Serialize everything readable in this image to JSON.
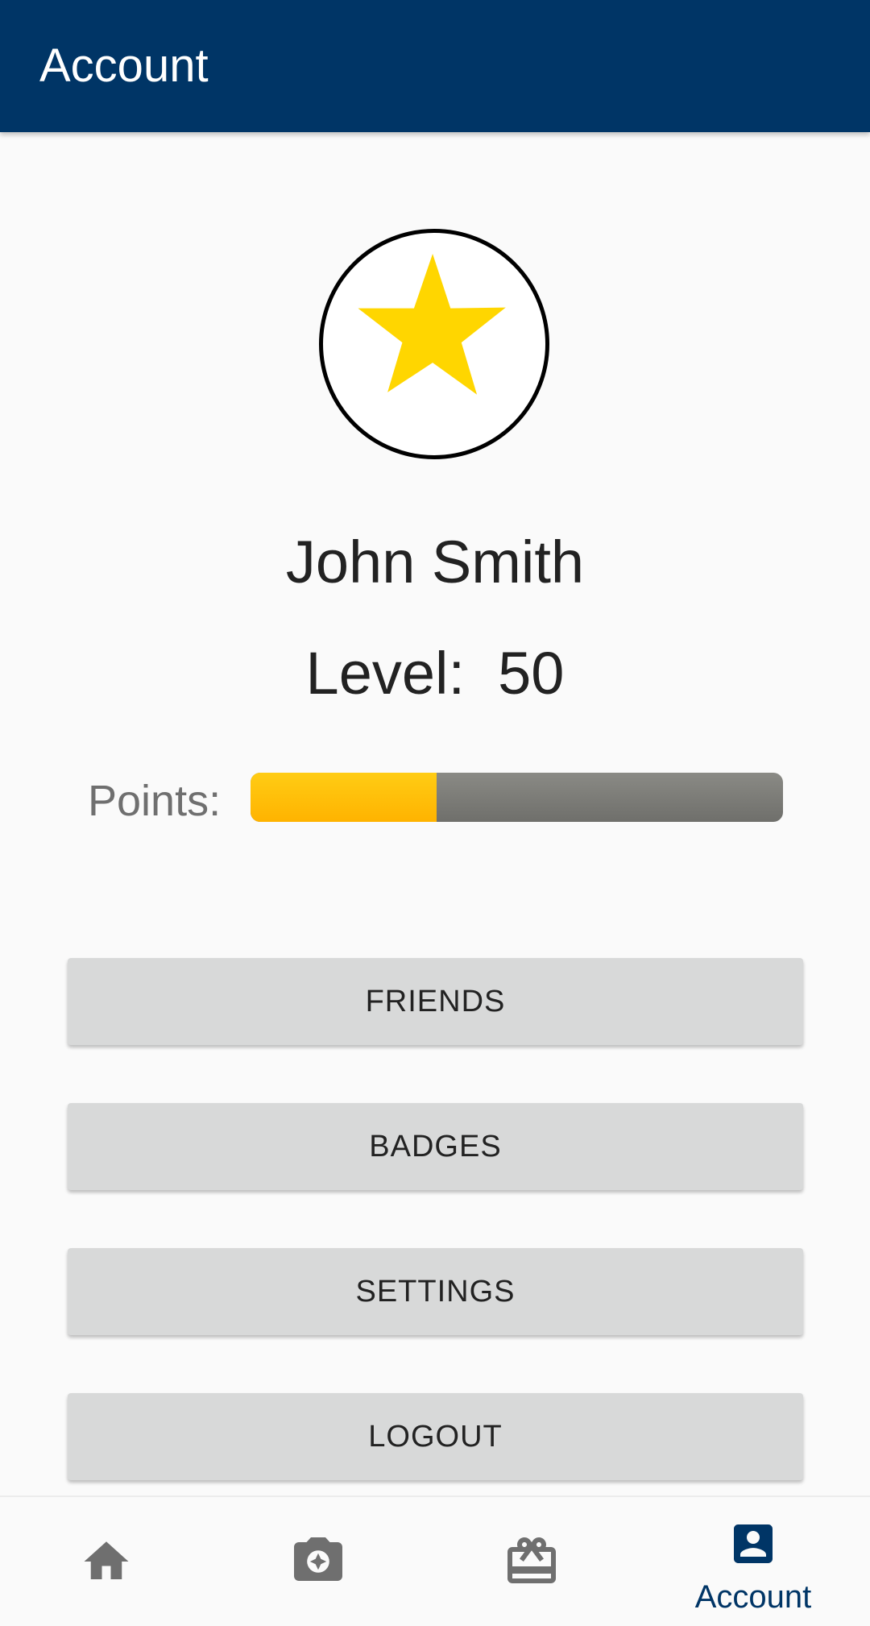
{
  "app_bar": {
    "title": "Account"
  },
  "profile": {
    "avatar_icon": "star-icon",
    "name": "John Smith",
    "level_label": "Level:",
    "level_value": "50",
    "points_label": "Points:",
    "points_progress_percent": 35
  },
  "menu": {
    "friends": "FRIENDS",
    "badges": "BADGES",
    "settings": "SETTINGS",
    "logout": "LOGOUT"
  },
  "bottom_nav": {
    "items": [
      {
        "icon": "home-icon",
        "label": ""
      },
      {
        "icon": "camera-icon",
        "label": ""
      },
      {
        "icon": "gift-card-icon",
        "label": ""
      },
      {
        "icon": "account-box-icon",
        "label": "Account",
        "active": true
      }
    ]
  },
  "colors": {
    "primary": "#003566",
    "star": "#ffd600",
    "progress_fill": "#ffbe0b",
    "progress_track": "#7a7a76",
    "button_bg": "#d8d9d9",
    "nav_inactive_icon": "#6f6f6f"
  }
}
